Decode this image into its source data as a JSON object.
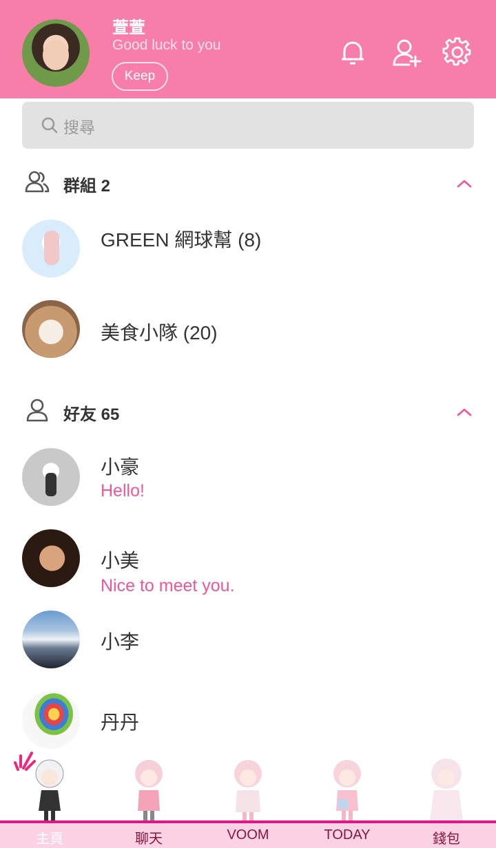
{
  "profile": {
    "name": "萱萱",
    "status": "Good luck to you",
    "keep_label": "Keep"
  },
  "header_icons": [
    "bell-icon",
    "add-friend-icon",
    "gear-icon"
  ],
  "search": {
    "placeholder": "搜尋"
  },
  "groups": {
    "title": "群組 2",
    "items": [
      {
        "name": "GREEN 網球幫 (8)"
      },
      {
        "name": "美食小隊 (20)"
      }
    ]
  },
  "friends": {
    "title": "好友 65",
    "items": [
      {
        "name": "小豪",
        "status": "Hello!"
      },
      {
        "name": "小美",
        "status": "Nice to meet you."
      },
      {
        "name": "小李",
        "status": ""
      },
      {
        "name": "丹丹",
        "status": ""
      }
    ]
  },
  "tabs": [
    {
      "label": "主頁",
      "active": true
    },
    {
      "label": "聊天",
      "active": false
    },
    {
      "label": "VOOM",
      "active": false
    },
    {
      "label": "TODAY",
      "active": false
    },
    {
      "label": "錢包",
      "active": false
    }
  ],
  "colors": {
    "header": "#f77ea9",
    "accent": "#f0559a",
    "tab_line": "#e7138a",
    "tab_bg": "#fbd3e4"
  }
}
